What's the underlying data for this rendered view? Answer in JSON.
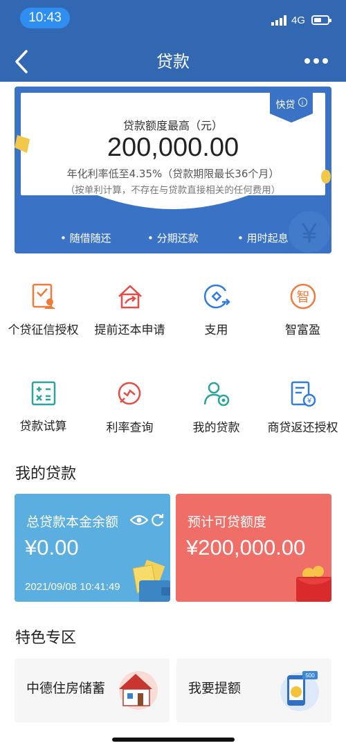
{
  "status_bar": {
    "time": "10:43",
    "network": "4G"
  },
  "header": {
    "title": "贷款"
  },
  "banner": {
    "ribbon_label": "快贷",
    "limit_label": "贷款额度最高（元）",
    "limit_value": "200,000.00",
    "rate_text": "年化利率低至4.35%（贷款期限最长36个月）",
    "note_text": "（按单利计算，不存在与贷款直接相关的任何费用）",
    "features": [
      "• 随借随还",
      "• 分期还款",
      "• 用时起息"
    ]
  },
  "services": [
    {
      "label": "个贷征信授权",
      "icon": "credit-auth-icon"
    },
    {
      "label": "提前还本申请",
      "icon": "early-repay-icon"
    },
    {
      "label": "支用",
      "icon": "drawdown-icon"
    },
    {
      "label": "智富盈",
      "icon": "zhifuying-icon"
    },
    {
      "label": "贷款试算",
      "icon": "calculator-icon"
    },
    {
      "label": "利率查询",
      "icon": "rate-query-icon"
    },
    {
      "label": "我的贷款",
      "icon": "my-loan-icon"
    },
    {
      "label": "商贷返还授权",
      "icon": "refund-auth-icon"
    }
  ],
  "my_loans": {
    "title": "我的贷款",
    "balance_card": {
      "label": "总贷款本金余额",
      "value": "¥0.00",
      "timestamp": "2021/09/08 10:41:49"
    },
    "available_card": {
      "label": "预计可贷额度",
      "value": "¥200,000.00"
    }
  },
  "special": {
    "title": "特色专区",
    "items": [
      {
        "label": "中德住房储蓄",
        "icon": "house-icon"
      },
      {
        "label": "我要提额",
        "icon": "phone-coin-icon"
      }
    ]
  },
  "colors": {
    "header_blue": "#3268b2",
    "banner_blue": "#3a73c6",
    "balance_card": "#5aaee0",
    "available_card": "#ef6f68",
    "icon_orange": "#f07a3a",
    "icon_red": "#e64b45",
    "icon_blue": "#2f7ae5",
    "icon_teal": "#2aa39a"
  }
}
